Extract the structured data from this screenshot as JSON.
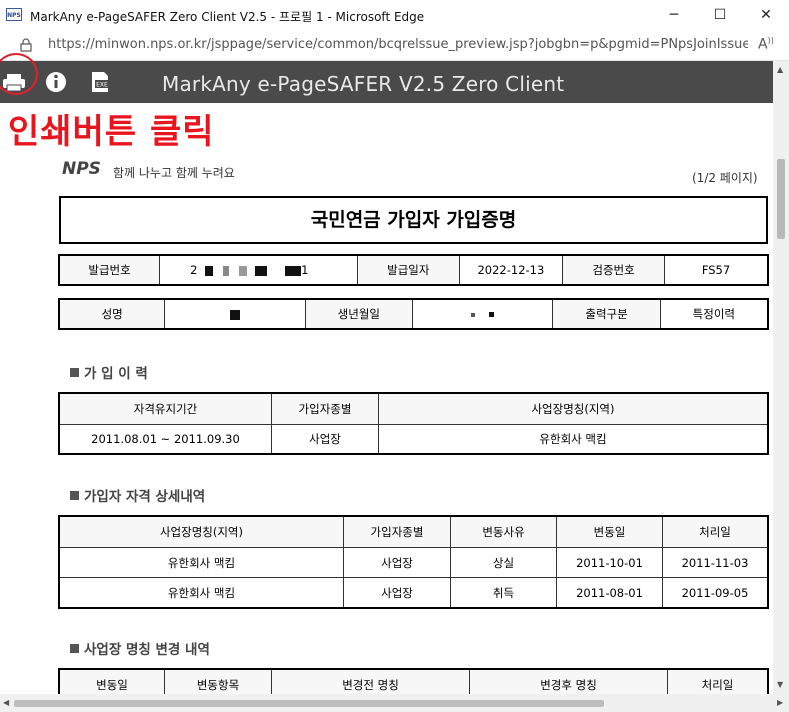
{
  "window": {
    "title": "MarkAny e-PageSAFER Zero Client V2.5 - 프로필 1 - Microsoft Edge",
    "app_icon_text": "NPS",
    "minimize": "─",
    "maximize": "☐",
    "close": "✕"
  },
  "address": {
    "url": "https://minwon.nps.or.kr/jsppage/service/common/bcqrelssue_preview.jsp?jobgbn=p&pgmid=PNpsJoinIssue&..."
  },
  "toolbar": {
    "title": "MarkAny e-PageSAFER V2.5 Zero Client",
    "icons": [
      "print-icon",
      "info-icon",
      "exe-icon"
    ]
  },
  "annotation": {
    "text": "인쇄버튼 클릭"
  },
  "doc": {
    "logo": "NPS",
    "slogan": "함께 나누고 함께 누려요",
    "page_indicator": "(1/2 페이지)",
    "title": "국민연금 가입자 가입증명",
    "issue_row": {
      "issue_no_label": "발급번호",
      "issue_no_value_prefix": "2",
      "issue_no_value_suffix": "1",
      "issue_date_label": "발급일자",
      "issue_date_value": "2022-12-13",
      "verify_no_label": "검증번호",
      "verify_no_value": "FS57"
    },
    "person_row": {
      "name_label": "성명",
      "birth_label": "생년월일",
      "output_label": "출력구분",
      "output_value": "특정이력"
    },
    "section1": {
      "title": "가 입 이 력",
      "headers": [
        "자격유지기간",
        "가입자종별",
        "사업장명칭(지역)"
      ],
      "rows": [
        [
          "2011.08.01 ~ 2011.09.30",
          "사업장",
          "유한회사 맥킴"
        ]
      ]
    },
    "section2": {
      "title": "가입자 자격 상세내역",
      "headers": [
        "사업장명칭(지역)",
        "가입자종별",
        "변동사유",
        "변동일",
        "처리일"
      ],
      "rows": [
        [
          "유한회사 맥킴",
          "사업장",
          "상실",
          "2011-10-01",
          "2011-11-03"
        ],
        [
          "유한회사 맥킴",
          "사업장",
          "취득",
          "2011-08-01",
          "2011-09-05"
        ]
      ]
    },
    "section3": {
      "title": "사업장 명칭 변경 내역",
      "headers": [
        "변동일",
        "변동항목",
        "변경전 명칭",
        "변경후 명칭",
        "처리일"
      ]
    }
  },
  "colors": {
    "toolbar_bg": "#4a4a4a",
    "annotation": "#e8141e"
  }
}
